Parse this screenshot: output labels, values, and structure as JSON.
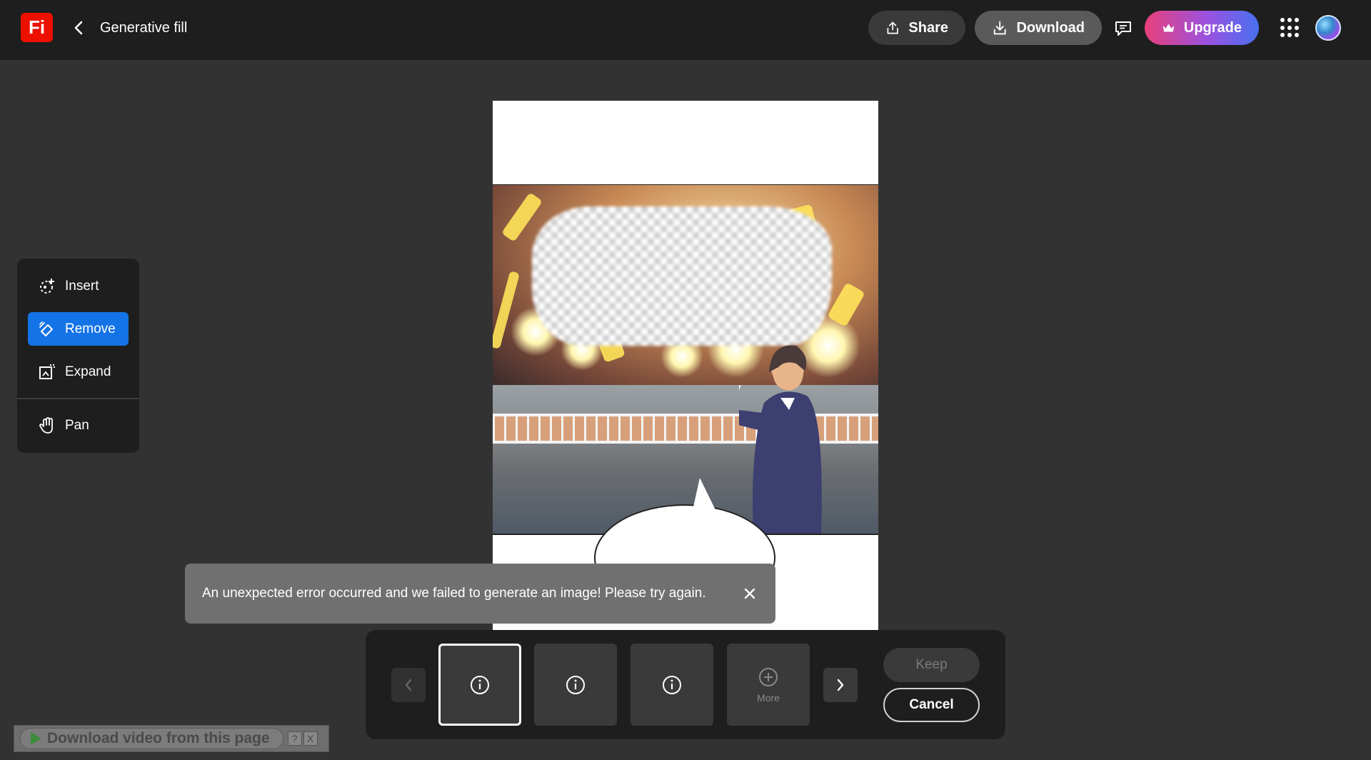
{
  "header": {
    "logo_text": "Fi",
    "title": "Generative fill",
    "share_label": "Share",
    "download_label": "Download",
    "upgrade_label": "Upgrade"
  },
  "tools": {
    "items": [
      {
        "label": "Insert",
        "icon": "insert-icon"
      },
      {
        "label": "Remove",
        "icon": "remove-icon",
        "active": true
      },
      {
        "label": "Expand",
        "icon": "expand-icon"
      },
      {
        "label": "Pan",
        "icon": "hand-icon"
      }
    ]
  },
  "toast": {
    "message": "An unexpected error occurred and we failed to generate an image! Please try again."
  },
  "variations": {
    "more_label": "More",
    "keep_label": "Keep",
    "cancel_label": "Cancel"
  },
  "extension": {
    "download_label": "Download video from this page",
    "help_label": "?",
    "close_label": "X"
  },
  "colors": {
    "accent": "#1473e6",
    "logo": "#eb1000",
    "background": "#323232",
    "toolbar": "#1e1e1e"
  }
}
